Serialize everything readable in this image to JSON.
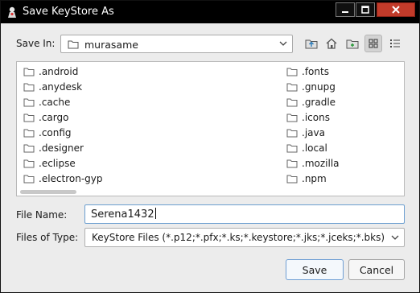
{
  "window": {
    "title": "Save KeyStore As"
  },
  "toolbar": {
    "save_in_label": "Save In:",
    "current_folder": "murasame"
  },
  "files": {
    "left": [
      ".android",
      ".anydesk",
      ".cache",
      ".cargo",
      ".config",
      ".designer",
      ".eclipse",
      ".electron-gyp"
    ],
    "right": [
      ".fonts",
      ".gnupg",
      ".gradle",
      ".icons",
      ".java",
      ".local",
      ".mozilla",
      ".npm"
    ]
  },
  "form": {
    "file_name_label": "File Name:",
    "file_name_value": "Serena1432",
    "file_type_label": "Files of Type:",
    "file_type_value": "KeyStore Files (*.p12;*.pfx;*.ks;*.keystore;*.jks;*.jceks;*.bks)"
  },
  "buttons": {
    "save": "Save",
    "cancel": "Cancel"
  },
  "colors": {
    "title_bar": "#000000",
    "close_button": "#c23b2a",
    "focus_border": "#6a9ed0"
  }
}
